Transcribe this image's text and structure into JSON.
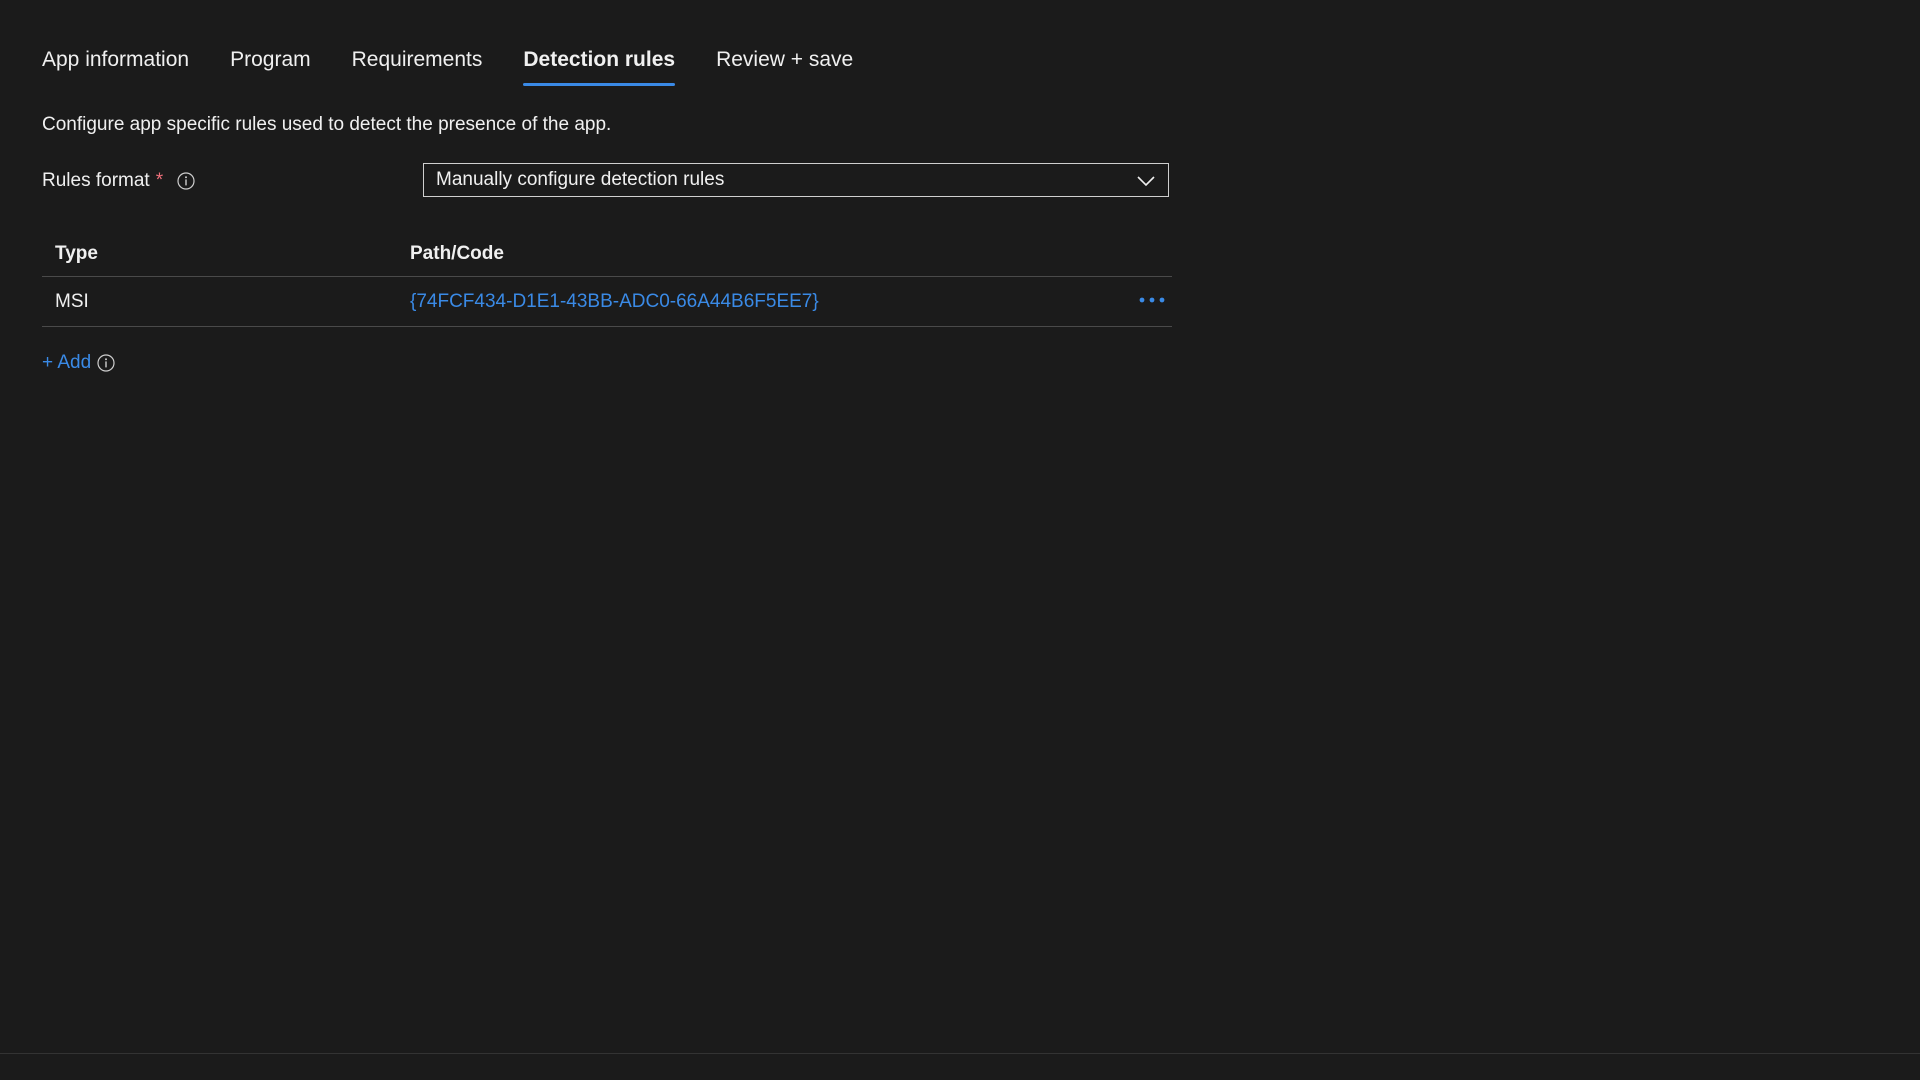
{
  "tabs": [
    {
      "label": "App information",
      "active": false
    },
    {
      "label": "Program",
      "active": false
    },
    {
      "label": "Requirements",
      "active": false
    },
    {
      "label": "Detection rules",
      "active": true
    },
    {
      "label": "Review + save",
      "active": false
    }
  ],
  "description": "Configure app specific rules used to detect the presence of the app.",
  "rules_format": {
    "label": "Rules format",
    "required_marker": "*",
    "value": "Manually configure detection rules"
  },
  "table": {
    "headers": {
      "type": "Type",
      "path": "Path/Code"
    },
    "rows": [
      {
        "type": "MSI",
        "path": "{74FCF434-D1E1-43BB-ADC0-66A44B6F5EE7}"
      }
    ]
  },
  "add_label": "+ Add",
  "colors": {
    "background": "#1b1b1b",
    "accent": "#3a8ae6",
    "required": "#f1707b"
  },
  "icons": {
    "info": "info-icon",
    "dropdown": "chevron-down-icon",
    "row_menu": "more-icon"
  }
}
